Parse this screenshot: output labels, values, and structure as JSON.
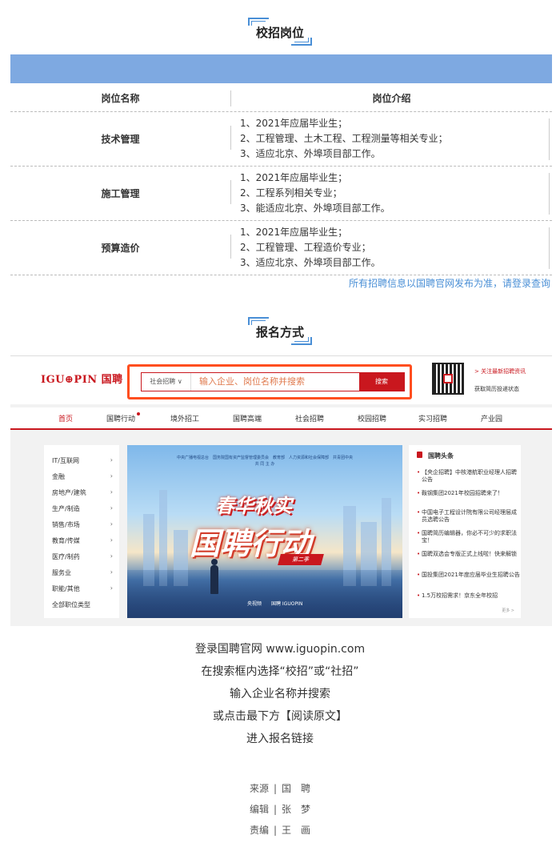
{
  "section1": {
    "title": "校招岗位"
  },
  "table": {
    "header": {
      "col1": "岗位名称",
      "col2": "岗位介绍"
    },
    "rows": [
      {
        "name": "技术管理",
        "lines": [
          "1、2021年应届毕业生；",
          "2、工程管理、土木工程、工程测量等相关专业；",
          "3、适应北京、外埠项目部工作。"
        ]
      },
      {
        "name": "施工管理",
        "lines": [
          "1、2021年应届毕业生；",
          "2、工程系列相关专业；",
          "3、能适应北京、外埠项目部工作。"
        ]
      },
      {
        "name": "预算造价",
        "lines": [
          "1、2021年应届毕业生；",
          "2、工程管理、工程造价专业；",
          "3、适应北京、外埠项目部工作。"
        ]
      }
    ]
  },
  "notice": "所有招聘信息以国聘官网发布为准，请登录查询",
  "section2": {
    "title": "报名方式"
  },
  "site": {
    "logo": "IGU⊕PIN 国聘",
    "search": {
      "select": "社会招聘 ∨",
      "placeholder": "输入企业、岗位名称并搜索",
      "button": "搜索"
    },
    "qr": {
      "line1": "> 关注最新招聘资讯",
      "line2": "获取简历投递状态"
    },
    "nav": [
      "首页",
      "国聘行动",
      "境外招工",
      "国聘高端",
      "社会招聘",
      "校园招聘",
      "实习招聘",
      "产业园"
    ],
    "categories": [
      "IT/互联网",
      "金融",
      "房地产/建筑",
      "生产/制造",
      "销售/市场",
      "教育/传媒",
      "医疗/制药",
      "服务业",
      "职能/其他",
      "全部职位类型"
    ],
    "banner": {
      "top1": "中央广播电视总台　国务院国有资产监督管理委员会　教育部　人力资源和社会保障部　共青团中央",
      "top2": "共 同 主 办",
      "t1": "春华秋实",
      "t2": "国聘行动",
      "season": "第二季",
      "logos": "央视频　　国聘 IGUOPIN"
    },
    "news": {
      "heading": "国聘头条",
      "items": [
        "【央企招聘】中核港航职业经理人招聘公告",
        "鞍钢集团2021年校园招聘来了！",
        "中国电子工程设计院有限公司经理层成员选聘公告",
        "国聘简历编辑器，你必不可少的求职法宝！",
        "国聘双选会专版正式上线啦！快来解锁",
        "国投集团2021年度应届毕业生招聘公告",
        "1.5万校招需求！京东全年校招"
      ],
      "more": "更多 >"
    }
  },
  "steps": [
    "登录国聘官网 www.iguopin.com",
    "在搜索框内选择“校招”或“社招”",
    "输入企业名称并搜索",
    "或点击最下方【阅读原文】",
    "进入报名链接"
  ],
  "credits": [
    {
      "k": "来源",
      "v": "国　聘"
    },
    {
      "k": "编辑",
      "v": "张　梦"
    },
    {
      "k": "责编",
      "v": "王　画"
    }
  ]
}
